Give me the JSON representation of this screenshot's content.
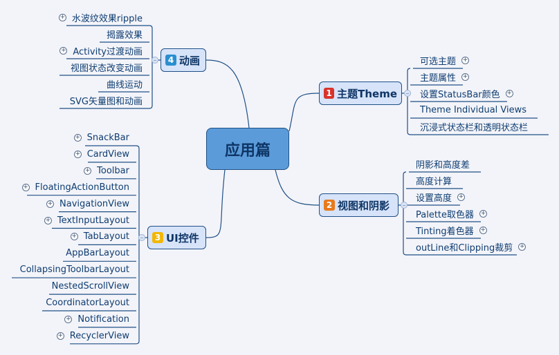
{
  "central_topic": "应用篇",
  "colors": {
    "background": "#f3f4f9",
    "central_fill": "#5b9bd9",
    "topic_fill": "#d6e3f9",
    "line": "#1f4f86",
    "text": "#0e3c71"
  },
  "topics": [
    {
      "id": "theme",
      "number": "1",
      "badge_color": "#d9332a",
      "label": "主题Theme",
      "side": "right",
      "children": [
        {
          "label": "可选主题",
          "expandable": true
        },
        {
          "label": "主题属性",
          "expandable": true
        },
        {
          "label": "设置StatusBar颜色",
          "expandable": true
        },
        {
          "label": "Theme Individual Views",
          "expandable": false
        },
        {
          "label": "沉浸式状态栏和透明状态栏",
          "expandable": false
        }
      ]
    },
    {
      "id": "shadow",
      "number": "2",
      "badge_color": "#e8791b",
      "label": "视图和阴影",
      "side": "right",
      "children": [
        {
          "label": "阴影和高度差",
          "expandable": false
        },
        {
          "label": "高度计算",
          "expandable": false
        },
        {
          "label": "设置高度",
          "expandable": true
        },
        {
          "label": "Palette取色器",
          "expandable": true
        },
        {
          "label": "Tinting着色器",
          "expandable": true
        },
        {
          "label": "outLine和Clipping裁剪",
          "expandable": true
        }
      ]
    },
    {
      "id": "ui",
      "number": "3",
      "badge_color": "#f2b705",
      "label": "UI控件",
      "side": "left",
      "children": [
        {
          "label": "SnackBar",
          "expandable": true
        },
        {
          "label": "CardView",
          "expandable": true
        },
        {
          "label": "Toolbar",
          "expandable": true
        },
        {
          "label": "FloatingActionButton",
          "expandable": true
        },
        {
          "label": "NavigationView",
          "expandable": true
        },
        {
          "label": "TextInputLayout",
          "expandable": true
        },
        {
          "label": "TabLayout",
          "expandable": true
        },
        {
          "label": "AppBarLayout",
          "expandable": false
        },
        {
          "label": "CollapsingToolbarLayout",
          "expandable": false
        },
        {
          "label": "NestedScrollView",
          "expandable": false
        },
        {
          "label": "CoordinatorLayout",
          "expandable": false
        },
        {
          "label": "Notification",
          "expandable": true
        },
        {
          "label": "RecyclerView",
          "expandable": true
        }
      ]
    },
    {
      "id": "anim",
      "number": "4",
      "badge_color": "#2a8fd0",
      "label": "动画",
      "side": "left",
      "children": [
        {
          "label": "水波纹效果ripple",
          "expandable": true
        },
        {
          "label": "揭露效果",
          "expandable": false
        },
        {
          "label": "Activity过渡动画",
          "expandable": true
        },
        {
          "label": "视图状态改变动画",
          "expandable": false
        },
        {
          "label": "曲线运动",
          "expandable": false
        },
        {
          "label": "SVG矢量图和动画",
          "expandable": false
        }
      ]
    }
  ]
}
